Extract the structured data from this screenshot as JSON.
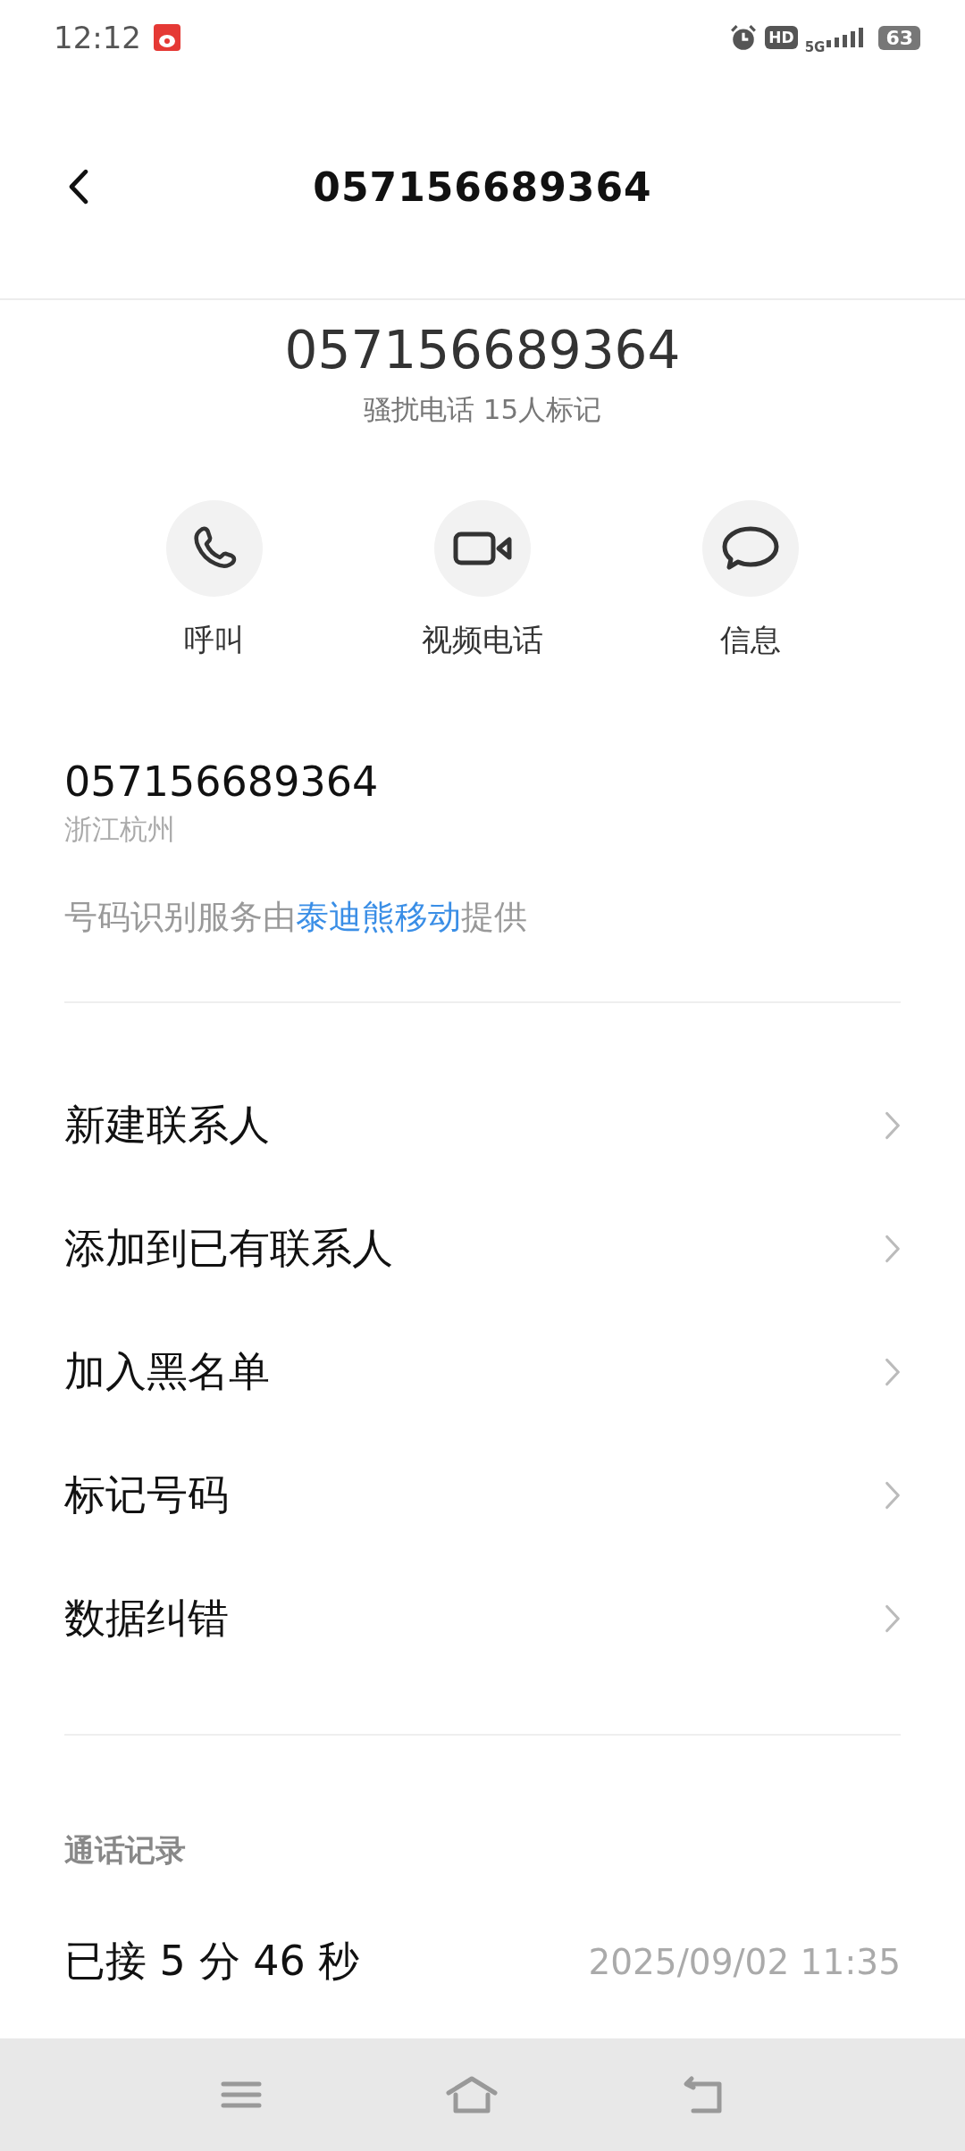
{
  "status_bar": {
    "time": "12:12",
    "hd": "HD",
    "network": "5G",
    "battery": "63"
  },
  "header": {
    "title": "057156689364"
  },
  "summary": {
    "number": "057156689364",
    "tag": "骚扰电话 15人标记"
  },
  "actions": [
    {
      "kind": "call",
      "label": "呼叫"
    },
    {
      "kind": "video",
      "label": "视频电话"
    },
    {
      "kind": "message",
      "label": "信息"
    }
  ],
  "number_info": {
    "number": "057156689364",
    "location": "浙江杭州",
    "provider_prefix": "号码识别服务由",
    "provider_link": "泰迪熊移动",
    "provider_suffix": "提供"
  },
  "menu": [
    {
      "label": "新建联系人"
    },
    {
      "label": "添加到已有联系人"
    },
    {
      "label": "加入黑名单"
    },
    {
      "label": "标记号码"
    },
    {
      "label": "数据纠错"
    }
  ],
  "call_log": {
    "title": "通话记录",
    "entries": [
      {
        "status": "已接 5 分 46 秒",
        "time": "2025/09/02 11:35"
      }
    ]
  }
}
